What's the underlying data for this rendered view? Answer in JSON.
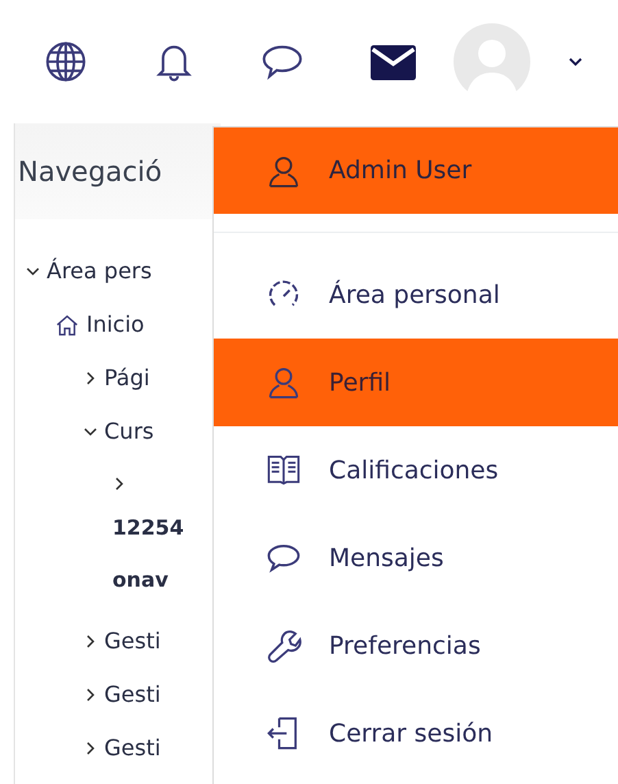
{
  "top_bar": {
    "icons": [
      {
        "kind": "globe"
      },
      {
        "kind": "bell"
      },
      {
        "kind": "chat"
      },
      {
        "kind": "mail"
      }
    ]
  },
  "navigation": {
    "title": "Navegació",
    "tree": [
      {
        "label": "Área pers",
        "kind": "branch",
        "expanded": true,
        "children": [
          {
            "label": "Inicio",
            "kind": "home",
            "children": [
              {
                "label": "Pági",
                "kind": "branch",
                "expanded": false
              },
              {
                "label": "Curs",
                "kind": "branch",
                "expanded": true,
                "children": [
                  {
                    "label": "12254 onav",
                    "kind": "course",
                    "expanded": false
                  }
                ]
              },
              {
                "label": "Gesti",
                "kind": "branch",
                "expanded": false
              },
              {
                "label": "Gesti",
                "kind": "branch",
                "expanded": false
              },
              {
                "label": "Gesti",
                "kind": "branch",
                "expanded": false
              }
            ]
          }
        ]
      }
    ]
  },
  "user_menu": {
    "header": {
      "label": "Admin User"
    },
    "items": [
      {
        "label": "Área personal",
        "kind": "gauge",
        "selected": false
      },
      {
        "label": "Perfil",
        "kind": "user",
        "selected": true
      },
      {
        "label": "Calificaciones",
        "kind": "book",
        "selected": false
      },
      {
        "label": "Mensajes",
        "kind": "chat",
        "selected": false
      },
      {
        "label": "Preferencias",
        "kind": "wrench",
        "selected": false
      },
      {
        "label": "Cerrar sesión",
        "kind": "logout",
        "selected": false
      }
    ]
  }
}
